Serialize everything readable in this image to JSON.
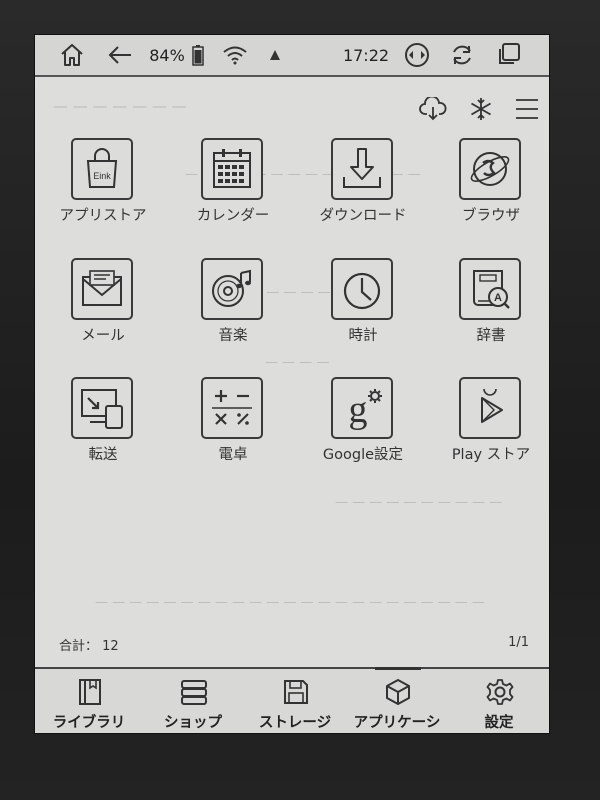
{
  "status": {
    "battery": "84%",
    "time": "17:22"
  },
  "apps": [
    {
      "label": "アプリストア",
      "icon": "app-store-bag-icon",
      "badge": "Eink"
    },
    {
      "label": "カレンダー",
      "icon": "calendar-icon"
    },
    {
      "label": "ダウンロード",
      "icon": "download-icon"
    },
    {
      "label": "ブラウザ",
      "icon": "browser-icon"
    },
    {
      "label": "メール",
      "icon": "mail-icon"
    },
    {
      "label": "音楽",
      "icon": "music-icon"
    },
    {
      "label": "時計",
      "icon": "clock-icon"
    },
    {
      "label": "辞書",
      "icon": "dictionary-icon",
      "badge": "A"
    },
    {
      "label": "転送",
      "icon": "transfer-icon"
    },
    {
      "label": "電卓",
      "icon": "calculator-icon"
    },
    {
      "label": "Google設定",
      "icon": "google-settings-icon",
      "badge": "g"
    },
    {
      "label": "Play ストア",
      "icon": "play-store-icon"
    }
  ],
  "footer": {
    "total": "合計： 12",
    "page": "1/1"
  },
  "nav": [
    {
      "label": "ライブラリ",
      "icon": "library-icon"
    },
    {
      "label": "ショップ",
      "icon": "shop-icon"
    },
    {
      "label": "ストレージ",
      "icon": "storage-icon"
    },
    {
      "label": "アプリケーシ",
      "icon": "apps-cube-icon",
      "active": true
    },
    {
      "label": "設定",
      "icon": "settings-gear-icon"
    }
  ],
  "colors": {
    "screen": "#dddddb",
    "ink": "#333333",
    "bezel": "#262626"
  }
}
